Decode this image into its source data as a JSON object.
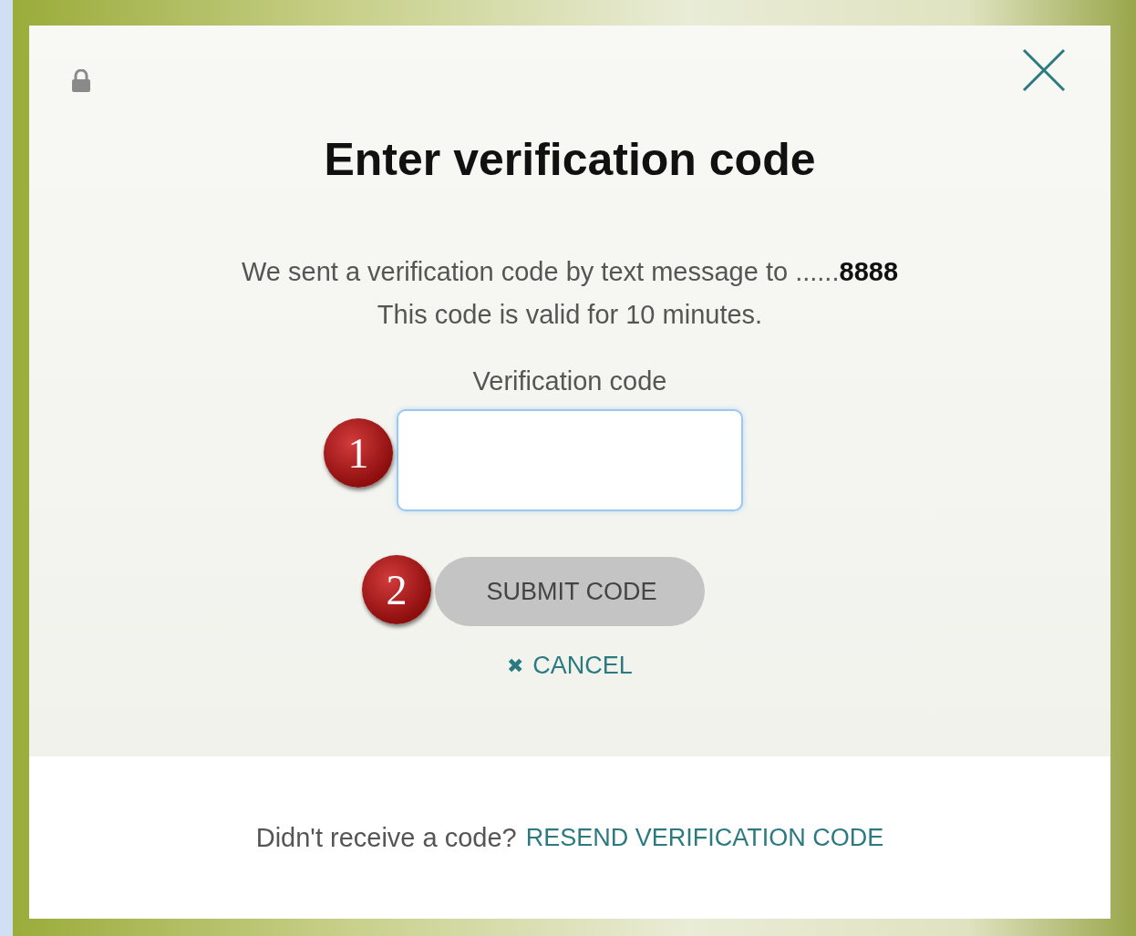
{
  "dialog": {
    "title": "Enter verification code",
    "message": "We sent a verification code by text message to ......**8888**",
    "validity": "This code is valid for 10 minutes.",
    "field": {
      "label": "Verification code"
    },
    "submit": {
      "label": "SUBMIT CODE",
      "disabled": true
    },
    "cancel": {
      "icon": "✖",
      "label": "CANCEL"
    },
    "footer": {
      "prompt": "Didn't receive a code?",
      "link": "RESEND VERIFICATION CODE"
    }
  },
  "callouts": [
    "1",
    "2"
  ]
}
